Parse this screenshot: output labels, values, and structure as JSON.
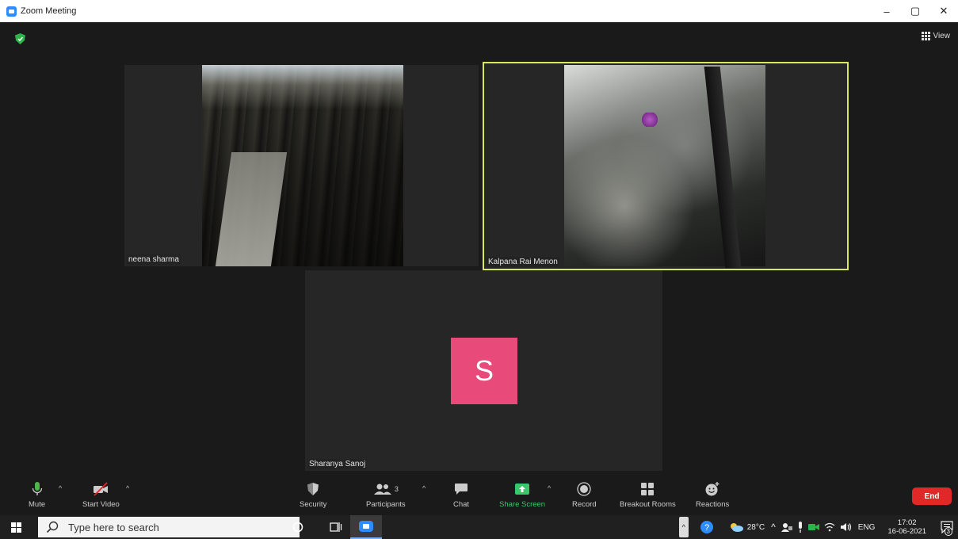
{
  "window": {
    "title": "Zoom Meeting",
    "minimize": "–",
    "maximize": "▢",
    "close": "✕"
  },
  "meeting": {
    "view_label": "View",
    "tiles": [
      {
        "name": "neena sharma",
        "active": false
      },
      {
        "name": "Kalpana Rai Menon",
        "active": true
      },
      {
        "name": "Sharanya Sanoj",
        "active": false,
        "avatar_initial": "S",
        "avatar_color": "#e84a7a"
      }
    ]
  },
  "toolbar": {
    "mute": "Mute",
    "start_video": "Start Video",
    "security": "Security",
    "participants": "Participants",
    "participants_count": "3",
    "chat": "Chat",
    "share_screen": "Share Screen",
    "record": "Record",
    "breakout_rooms": "Breakout Rooms",
    "reactions": "Reactions",
    "end": "End",
    "caret": "^"
  },
  "taskbar": {
    "search_placeholder": "Type here to search",
    "weather": "28°C",
    "language": "ENG",
    "time": "17:02",
    "date": "16-06-2021",
    "notifications_count": "3",
    "tray_caret": "^"
  },
  "colors": {
    "share_green": "#38c86b",
    "end_red": "#e02828",
    "active_speaker": "#d8e85a",
    "zoom_blue": "#2d8cff"
  }
}
